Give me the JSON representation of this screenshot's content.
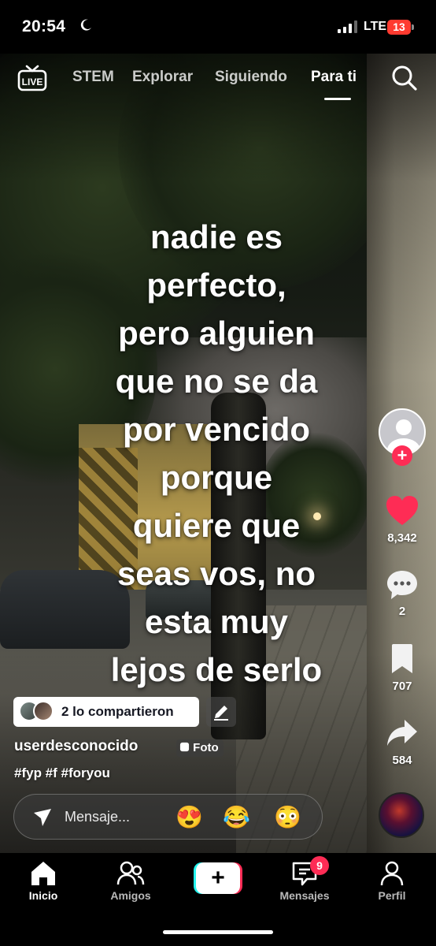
{
  "status_bar": {
    "time": "20:54",
    "network": "LTE",
    "battery": "13"
  },
  "top_nav": {
    "live_label": "LIVE",
    "tabs": [
      {
        "label": "STEM",
        "active": false
      },
      {
        "label": "Explorar",
        "active": false
      },
      {
        "label": "Siguiendo",
        "active": false
      },
      {
        "label": "Para ti",
        "active": true
      }
    ]
  },
  "post": {
    "caption_lines": [
      "nadie es",
      "perfecto,",
      "pero alguien",
      "que no se da",
      "por vencido",
      "porque",
      "quiere que",
      "seas vos, no",
      "esta muy",
      "lejos de serlo"
    ],
    "shared_by": "2 lo compartieron",
    "username": "userdesconocido",
    "type_badge": "Foto",
    "hashtags": "#fyp #f #foryou"
  },
  "actions": {
    "likes": "8,342",
    "comments": "2",
    "saves": "707",
    "shares": "584"
  },
  "message_bar": {
    "placeholder": "Mensaje...",
    "emojis": [
      "😍",
      "😂",
      "😳"
    ]
  },
  "tab_bar": {
    "items": [
      {
        "label": "Inicio",
        "icon": "home-icon",
        "active": true
      },
      {
        "label": "Amigos",
        "icon": "friends-icon",
        "active": false
      },
      {
        "label": "Mensajes",
        "icon": "inbox-icon",
        "active": false,
        "badge": "9"
      },
      {
        "label": "Perfil",
        "icon": "profile-icon",
        "active": false
      }
    ]
  },
  "colors": {
    "accent": "#fe2c55",
    "cyan": "#25f4ee",
    "battery": "#ff3b30"
  }
}
